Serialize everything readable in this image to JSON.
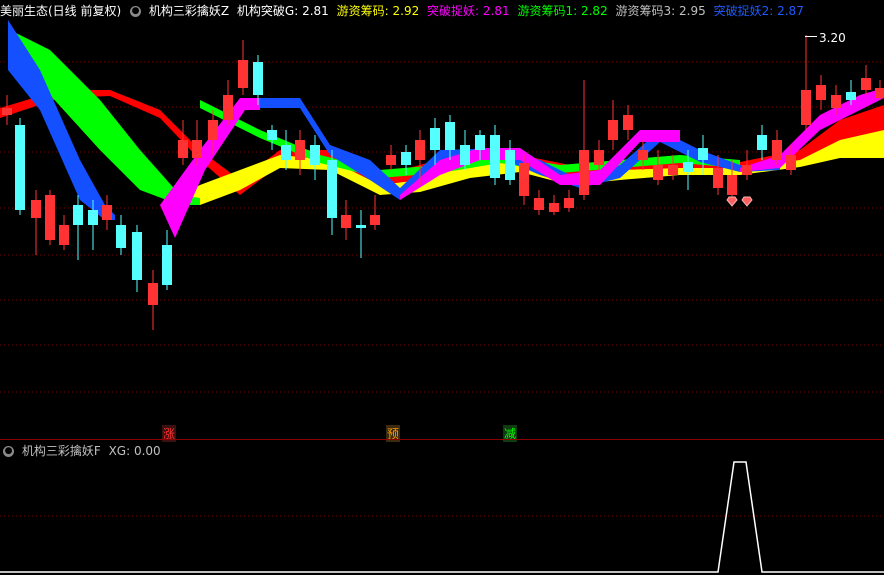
{
  "main_panel": {
    "stock_title": "美丽生态(日线 前复权)",
    "indicator_name": "机构三彩擒妖Z",
    "values": [
      {
        "label": "机构突破G:",
        "value": "2.81",
        "color": "#ffffff"
      },
      {
        "label": "游资筹码:",
        "value": "2.92",
        "color": "#ffff00"
      },
      {
        "label": "突破捉妖:",
        "value": "2.81",
        "color": "#ff00ff"
      },
      {
        "label": "游资筹码1:",
        "value": "2.82",
        "color": "#00ff00"
      },
      {
        "label": "游资筹码3:",
        "value": "2.95",
        "color": "#c0c0c0"
      },
      {
        "label": "突破捉妖2:",
        "value": "2.87",
        "color": "#1e5bff"
      }
    ],
    "high_marker": "3.20",
    "signal_labels": [
      {
        "text": "涨",
        "color": "#ff3030"
      },
      {
        "text": "预",
        "color": "#ff9900"
      },
      {
        "text": "减",
        "color": "#00ff00"
      }
    ]
  },
  "sub_panel": {
    "indicator_name": "机构三彩擒妖F",
    "value_label": "XG:",
    "value": "0.00"
  },
  "colors": {
    "up": "#ff3333",
    "down": "#55ffff",
    "grid": "#7a0000",
    "band_blue": "#1450ff",
    "band_green": "#00ff00",
    "band_magenta": "#ff00ff",
    "band_red": "#ff0000",
    "band_yellow": "#ffff00"
  }
}
